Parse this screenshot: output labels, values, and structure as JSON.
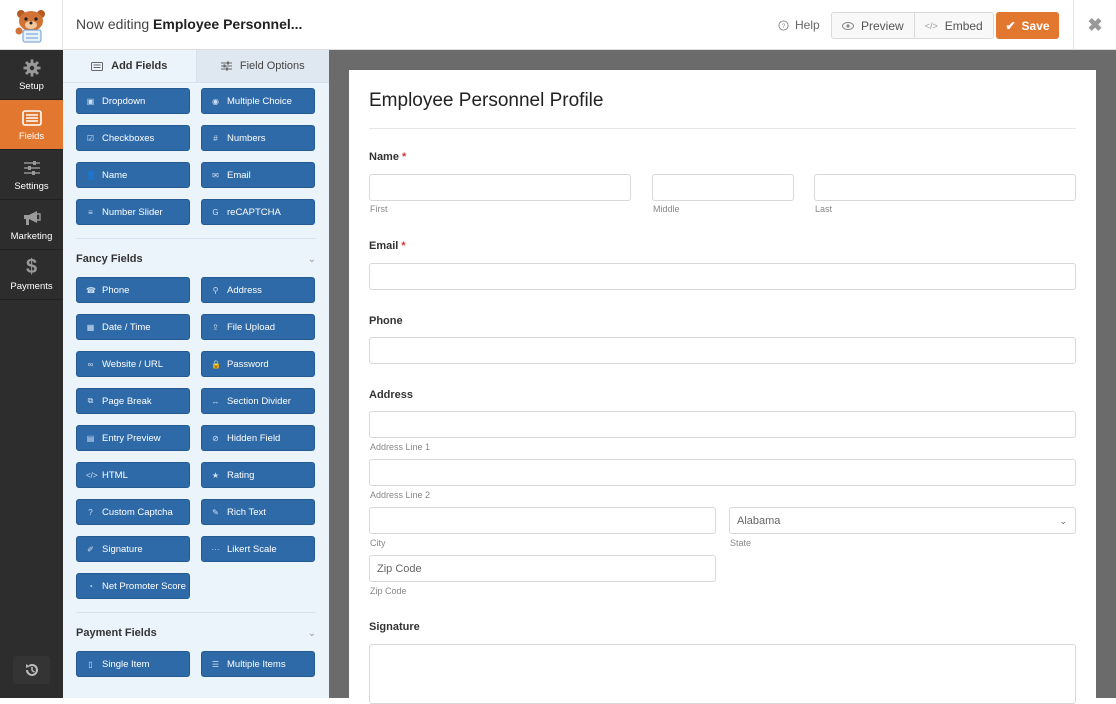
{
  "header": {
    "title_prefix": "Now editing",
    "title_form": "Employee Personnel...",
    "help_label": "Help",
    "preview_label": "Preview",
    "embed_label": "Embed",
    "save_label": "Save",
    "close_symbol": "✖",
    "colors": {
      "accent": "#e27730",
      "field_button": "#2f6aa8"
    }
  },
  "leftnav": {
    "items": [
      {
        "label": "Setup",
        "icon": "gear-icon",
        "active": false
      },
      {
        "label": "Fields",
        "icon": "fields-list-icon",
        "active": true
      },
      {
        "label": "Settings",
        "icon": "sliders-icon",
        "active": false
      },
      {
        "label": "Marketing",
        "icon": "megaphone-icon",
        "active": false
      },
      {
        "label": "Payments",
        "icon": "dollar-icon",
        "active": false
      }
    ]
  },
  "panel": {
    "tabs": [
      {
        "label": "Add Fields",
        "active": true
      },
      {
        "label": "Field Options",
        "active": false
      }
    ],
    "standard_fields": [
      {
        "label": "Dropdown",
        "glyph": "▣"
      },
      {
        "label": "Multiple Choice",
        "glyph": "◉"
      },
      {
        "label": "Checkboxes",
        "glyph": "☑"
      },
      {
        "label": "Numbers",
        "glyph": "#"
      },
      {
        "label": "Name",
        "glyph": "👤"
      },
      {
        "label": "Email",
        "glyph": "✉"
      },
      {
        "label": "Number Slider",
        "glyph": "≡"
      },
      {
        "label": "reCAPTCHA",
        "glyph": "G"
      }
    ],
    "fancy_section": "Fancy Fields",
    "fancy_fields": [
      {
        "label": "Phone",
        "glyph": "☎"
      },
      {
        "label": "Address",
        "glyph": "⚲"
      },
      {
        "label": "Date / Time",
        "glyph": "▦"
      },
      {
        "label": "File Upload",
        "glyph": "⇪"
      },
      {
        "label": "Website / URL",
        "glyph": "∞"
      },
      {
        "label": "Password",
        "glyph": "🔒"
      },
      {
        "label": "Page Break",
        "glyph": "⧉"
      },
      {
        "label": "Section Divider",
        "glyph": "↔"
      },
      {
        "label": "Entry Preview",
        "glyph": "▤"
      },
      {
        "label": "Hidden Field",
        "glyph": "⊘"
      },
      {
        "label": "HTML",
        "glyph": "</>"
      },
      {
        "label": "Rating",
        "glyph": "★"
      },
      {
        "label": "Custom Captcha",
        "glyph": "?"
      },
      {
        "label": "Rich Text",
        "glyph": "✎"
      },
      {
        "label": "Signature",
        "glyph": "✐"
      },
      {
        "label": "Likert Scale",
        "glyph": "···"
      },
      {
        "label": "Net Promoter Score",
        "glyph": "◔"
      }
    ],
    "payment_section": "Payment Fields",
    "payment_fields": [
      {
        "label": "Single Item",
        "glyph": "▯"
      },
      {
        "label": "Multiple Items",
        "glyph": "☰"
      }
    ]
  },
  "form": {
    "title": "Employee Personnel Profile",
    "name_label": "Name",
    "name_sub": {
      "first": "First",
      "middle": "Middle",
      "last": "Last"
    },
    "email_label": "Email",
    "required_marker": "*",
    "phone_label": "Phone",
    "address_label": "Address",
    "address_sub": {
      "line1": "Address Line 1",
      "line2": "Address Line 2",
      "city": "City",
      "state": "State",
      "zip": "Zip Code"
    },
    "state_value": "Alabama",
    "zip_placeholder": "Zip Code",
    "signature_label": "Signature"
  }
}
